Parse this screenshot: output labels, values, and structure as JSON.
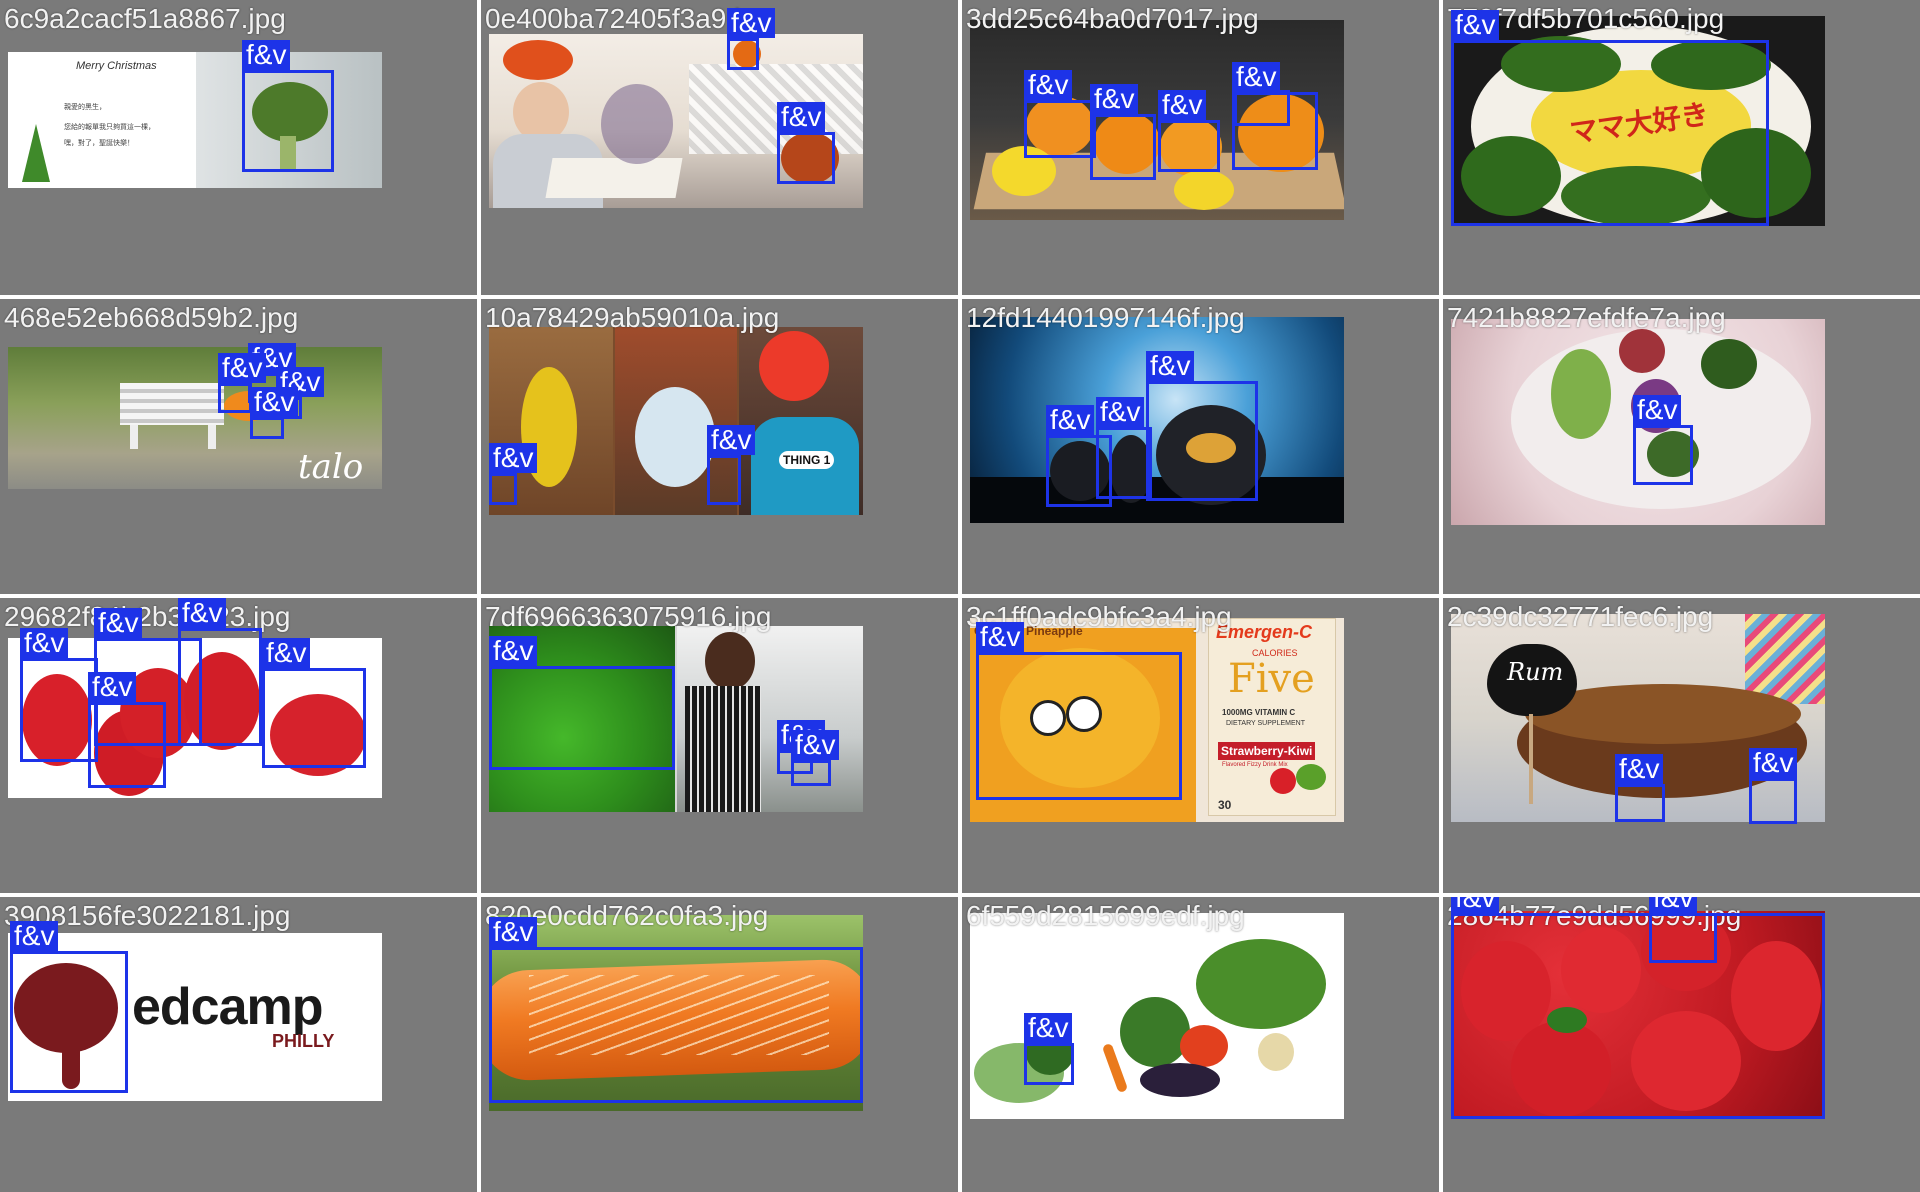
{
  "tag_label": "f&v",
  "tiles": [
    {
      "filename": "6c9a2cacf51a8867.jpg",
      "scene": "christmas-card-broccoli",
      "card_text": [
        "Merry Christmas",
        "親愛的黑生，",
        "您給的報單我只夠買這一棵，",
        "嘿，對了，聖誕快樂！"
      ]
    },
    {
      "filename": "0e400ba72405f3a9.jpg",
      "scene": "child-with-balloon-hat"
    },
    {
      "filename": "3dd25c64ba0d7017.jpg",
      "scene": "citrus-tray"
    },
    {
      "filename": "772f7df5b701c560.jpg",
      "scene": "broccoli-omurice",
      "plate_text": "ママ大好き"
    },
    {
      "filename": "468e52eb668d59b2.jpg",
      "scene": "park-bench",
      "signature": "talo"
    },
    {
      "filename": "10a78429ab59010a.jpg",
      "scene": "halloween-costumes",
      "shirt_text": "THING 1"
    },
    {
      "filename": "12fd14401997146f.jpg",
      "scene": "halloween-pumpkins-night"
    },
    {
      "filename": "7421b8827efdfe7a.jpg",
      "scene": "vegetable-soup"
    },
    {
      "filename": "29682f84b2b33a23.jpg",
      "scene": "strawberries-white"
    },
    {
      "filename": "7df6966363075916.jpg",
      "scene": "green-peppers-kitchen"
    },
    {
      "filename": "3c1ff0adc9bfc3a4.jpg",
      "scene": "emergen-c-box",
      "box_text": {
        "brand": "Emergen-C",
        "sub": "CALORIES",
        "five": "Five",
        "vit": "1000MG VITAMIN C",
        "supp": "DIETARY SUPPLEMENT",
        "flavor": "Strawberry-Kiwi",
        "fizzy": "Flavored Fizzy Drink Mix",
        "count": "30",
        "coconut": "Coconut Pineapple"
      }
    },
    {
      "filename": "2c39dc32771fec6.jpg",
      "scene": "rum-cake",
      "sign_text": "Rum"
    },
    {
      "filename": "3908156fe3022181.jpg",
      "scene": "edcamp-logo",
      "logo_text": {
        "main": "edcamp",
        "sub": "PHILLY"
      }
    },
    {
      "filename": "820e0cdd762c0fa3.jpg",
      "scene": "carrot-macro"
    },
    {
      "filename": "6f559d2815699edf.jpg",
      "scene": "vegetable-pile"
    },
    {
      "filename": "2864b77e9dd56999.jpg",
      "scene": "strawberry-pile"
    }
  ]
}
